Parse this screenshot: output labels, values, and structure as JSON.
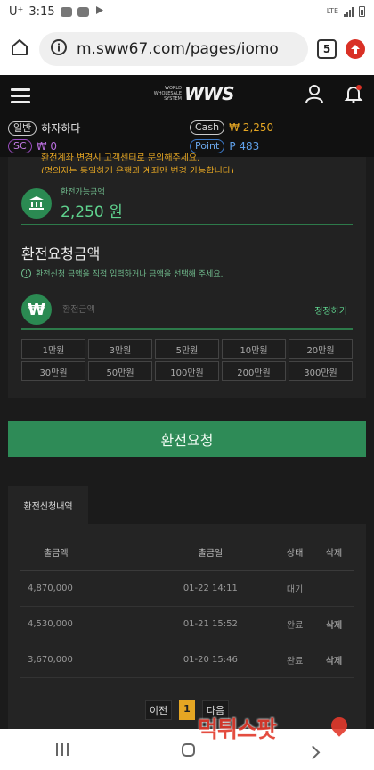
{
  "status_bar": {
    "carrier": "U⁺",
    "time": "3:15",
    "network": "LTE"
  },
  "browser": {
    "url": "m.sww67.com/pages/iomo",
    "tab_count": "5"
  },
  "header": {
    "logo_small": "WORLD WHOLESALE SYSTEM",
    "logo_big": "WWS"
  },
  "user": {
    "grade_label": "일반",
    "nickname": "하자하다",
    "sc_label": "SC",
    "sc_value": "₩ 0",
    "cash_label": "Cash",
    "cash_value": "₩ 2,250",
    "point_label": "Point",
    "point_value": "P 483"
  },
  "withdraw": {
    "notice_line1": "환전계좌 변경시 고객센터로 문의해주세요.",
    "notice_line2": "(명의자는 동일하게 은행과 계좌만 변경 가능합니다)",
    "available_label": "환전가능금액",
    "available_amount": "2,250 원",
    "request_title": "환전요청금액",
    "request_hint": "환전신청 금액을 직접 입력하거나 금액을 선택해 주세요.",
    "input_placeholder": "환전금액",
    "correct_label": "정정하기",
    "currency_symbol": "₩",
    "amount_buttons": [
      "1만원",
      "3만원",
      "5만원",
      "10만원",
      "20만원",
      "30만원",
      "50만원",
      "100만원",
      "200만원",
      "300만원"
    ],
    "submit_label": "환전요청"
  },
  "history": {
    "tab_label": "환전신청내역",
    "columns": [
      "출금액",
      "출금일",
      "상태",
      "삭제"
    ],
    "rows": [
      {
        "amount": "4,870,000",
        "date": "01-22 14:11",
        "status": "대기",
        "delete": ""
      },
      {
        "amount": "4,530,000",
        "date": "01-21 15:52",
        "status": "완료",
        "delete": "삭제"
      },
      {
        "amount": "3,670,000",
        "date": "01-20 15:46",
        "status": "완료",
        "delete": "삭제"
      }
    ],
    "pager": {
      "prev": "이전",
      "current": "1",
      "next": "다음"
    }
  },
  "watermark": "먹튀스팟",
  "colors": {
    "accent_green": "#2e8b57",
    "gold": "#e5a623",
    "purple": "#9a4cc0",
    "blue": "#3b79c9"
  }
}
